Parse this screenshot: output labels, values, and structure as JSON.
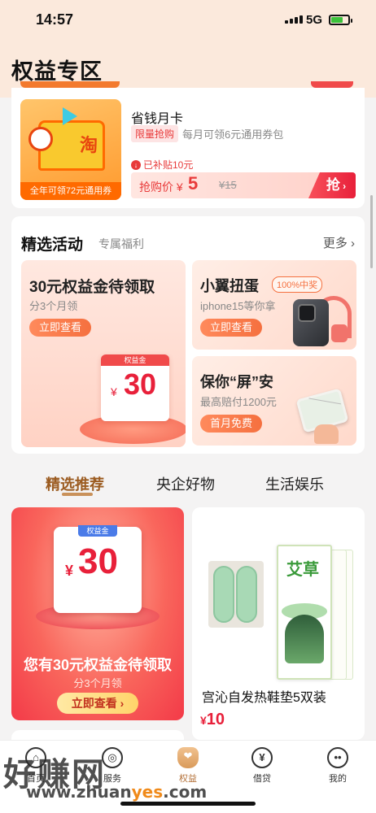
{
  "status_bar": {
    "time": "14:57",
    "network": "5G"
  },
  "header": {
    "title": "权益专区"
  },
  "card_monthly": {
    "image_caption": "全年可领72元通用券",
    "title": "省钱月卡",
    "tag": "限量抢购",
    "desc": "每月可领6元通用券包",
    "subsidy": "已补贴10元",
    "price_label": "抢购价",
    "price_currency": "¥",
    "price": "5",
    "original_price": "¥15",
    "buy_label": "抢"
  },
  "activities": {
    "title": "精选活动",
    "subtitle": "专属福利",
    "more": "更多",
    "big": {
      "title": "30元权益金待领取",
      "sub": "分3个月领",
      "button": "立即查看",
      "coupon_label": "权益金",
      "coupon_currency": "¥",
      "coupon_value": "30"
    },
    "gacha": {
      "title": "小翼扭蛋",
      "badge": "100%中奖",
      "sub": "iphone15等你拿",
      "button": "立即查看"
    },
    "screen": {
      "title": "保你“屏”安",
      "sub": "最高赔付1200元",
      "button": "首月免费"
    }
  },
  "tabs": [
    {
      "label": "精选推荐",
      "active": true
    },
    {
      "label": "央企好物",
      "active": false
    },
    {
      "label": "生活娱乐",
      "active": false
    }
  ],
  "promo": {
    "coupon_label": "权益金",
    "coupon_currency": "¥",
    "coupon_value": "30",
    "title": "您有30元权益金待领取",
    "sub": "分3个月领",
    "button": "立即查看 ›"
  },
  "product": {
    "package_logo": "艾草",
    "name": "宫沁自发热鞋垫5双装",
    "currency": "¥",
    "price": "10"
  },
  "tabbar": [
    {
      "label": "首页",
      "icon": "home-icon",
      "glyph": "⌂",
      "active": false
    },
    {
      "label": "服务",
      "icon": "service-icon",
      "glyph": "◎",
      "active": false
    },
    {
      "label": "权益",
      "icon": "benefits-icon",
      "glyph": "❤",
      "active": true
    },
    {
      "label": "借贷",
      "icon": "loan-icon",
      "glyph": "¥",
      "active": false
    },
    {
      "label": "我的",
      "icon": "profile-icon",
      "glyph": "••",
      "active": false
    }
  ],
  "watermark": {
    "text": "好赚网",
    "url_prefix": "www.zhuan",
    "url_accent": "yes",
    "url_suffix": ".com"
  },
  "colors": {
    "accent_red": "#e8203a",
    "accent_orange": "#f5703f",
    "tab_active": "#9b5b20",
    "page_bg": "#f4f3f3",
    "header_bg": "#fbe9dc"
  }
}
